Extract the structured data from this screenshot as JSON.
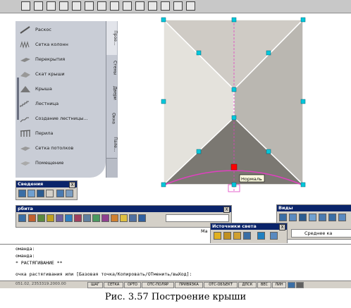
{
  "palette": {
    "items": [
      {
        "label": "Раскос",
        "icon": "brace-icon"
      },
      {
        "label": "Сетка колонн",
        "icon": "column-grid-icon"
      },
      {
        "label": "Перекрытия",
        "icon": "slab-icon"
      },
      {
        "label": "Скат крыши",
        "icon": "roof-slope-icon"
      },
      {
        "label": "Крыша",
        "icon": "roof-icon"
      },
      {
        "label": "Лестница",
        "icon": "stair-icon"
      },
      {
        "label": "Создание лестницы...",
        "icon": "create-stair-icon"
      },
      {
        "label": "Перила",
        "icon": "railing-icon"
      },
      {
        "label": "Сетка потолков",
        "icon": "ceiling-grid-icon"
      },
      {
        "label": "Помещение",
        "icon": "space-icon"
      }
    ],
    "tabs": [
      "Прое...",
      "Стены",
      "Двери",
      "Окна",
      "Пале..."
    ]
  },
  "tooltip": "Нормаль",
  "panels": {
    "info": {
      "title": "Сведения",
      "close": "X"
    },
    "orbit": {
      "title": "рбита",
      "close": "X"
    },
    "views": {
      "title": "Виды",
      "close": "X",
      "dropdown": "Среднее ка"
    },
    "lights": {
      "title": "Источники света",
      "close": "X"
    },
    "partial_label": "Ма"
  },
  "command_line": [
    "оманда:",
    "оманда:",
    "* РАСТЯГИВАНИЕ **",
    "очка растягивания или [Базовая точка/Копировать/ОТменить/выХод]:"
  ],
  "status_bar": {
    "coordinates": "051.02, 2353319.2000.00",
    "buttons": [
      "ШАГ",
      "СЕТКА",
      "ОРТО",
      "ОТС-ПОЛЯР",
      "ПРИВЯЗКА",
      "ОТС-ОБЪЕКТ",
      "ДПСК",
      "ВЕС",
      "ЛИН"
    ]
  },
  "caption": "Рис. 3.57 Построение крыши",
  "colors": {
    "roof_top": "#cfcbc5",
    "roof_left": "#e4e2dc",
    "roof_right": "#bab7b1",
    "roof_bottom": "#7b7872",
    "grip": "#00c8dc",
    "selected_grip": "#ff0000",
    "dashed_outline": "#e040c0",
    "panel_title": "#0a246a"
  }
}
